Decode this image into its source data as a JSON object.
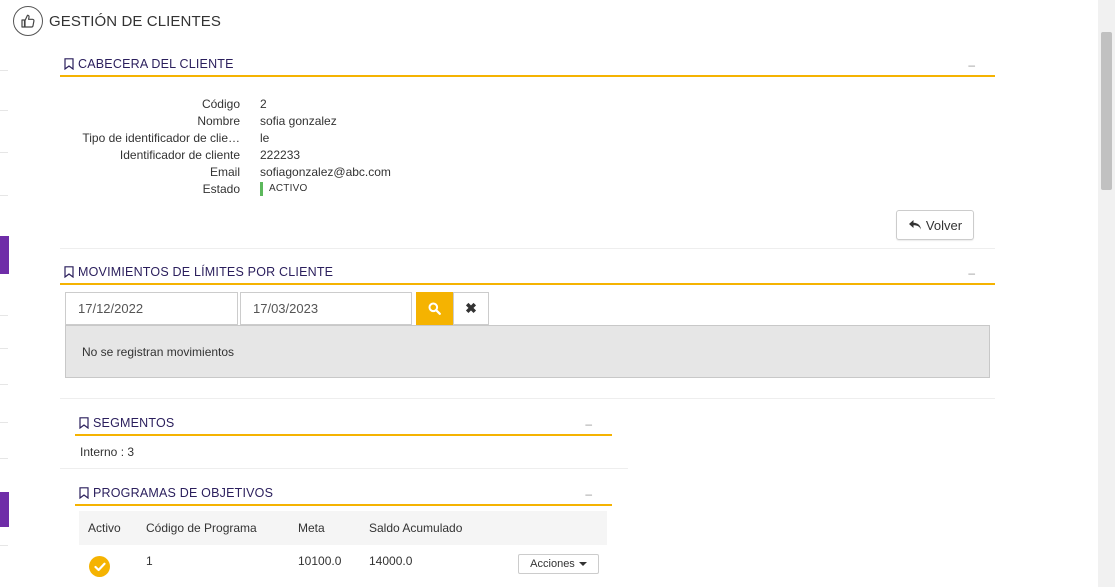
{
  "app": {
    "title": "GESTIÓN DE CLIENTES",
    "icon": "thumbs-up-icon"
  },
  "header_section": {
    "title": "CABECERA DEL CLIENTE",
    "collapse": "–",
    "fields": [
      {
        "label": "Código",
        "value": "2"
      },
      {
        "label": "Nombre",
        "value": "sofia gonzalez"
      },
      {
        "label": "Tipo de identificador de clie…",
        "value": "le"
      },
      {
        "label": "Identificador de cliente",
        "value": "222233"
      },
      {
        "label": "Email",
        "value": "sofiagonzalez@abc.com"
      }
    ],
    "status": {
      "label": "Estado",
      "value": "ACTIVO",
      "color": "#5cb85c"
    },
    "back_button": {
      "label": "Volver",
      "icon": "reply-icon"
    }
  },
  "movements": {
    "title": "MOVIMIENTOS DE LÍMITES POR CLIENTE",
    "collapse": "–",
    "date_from": "17/12/2022",
    "date_to": "17/03/2023",
    "search_icon": "search-icon",
    "clear_icon": "close-icon",
    "clear_glyph": "✖",
    "empty_message": "No se registran movimientos"
  },
  "segments": {
    "title": "SEGMENTOS",
    "collapse": "–",
    "value": "Interno : 3"
  },
  "programs": {
    "title": "PROGRAMAS DE OBJETIVOS",
    "collapse": "–",
    "columns": [
      "Activo",
      "Código de Programa",
      "Meta",
      "Saldo Acumulado"
    ],
    "rows": [
      {
        "active": true,
        "code": "1",
        "goal": "10100.0",
        "balance": "14000.0",
        "actions_label": "Acciones"
      }
    ]
  },
  "colors": {
    "accent": "#f5b301",
    "title": "#2a1e5c",
    "sidebar_mark": "#6f2da8"
  }
}
